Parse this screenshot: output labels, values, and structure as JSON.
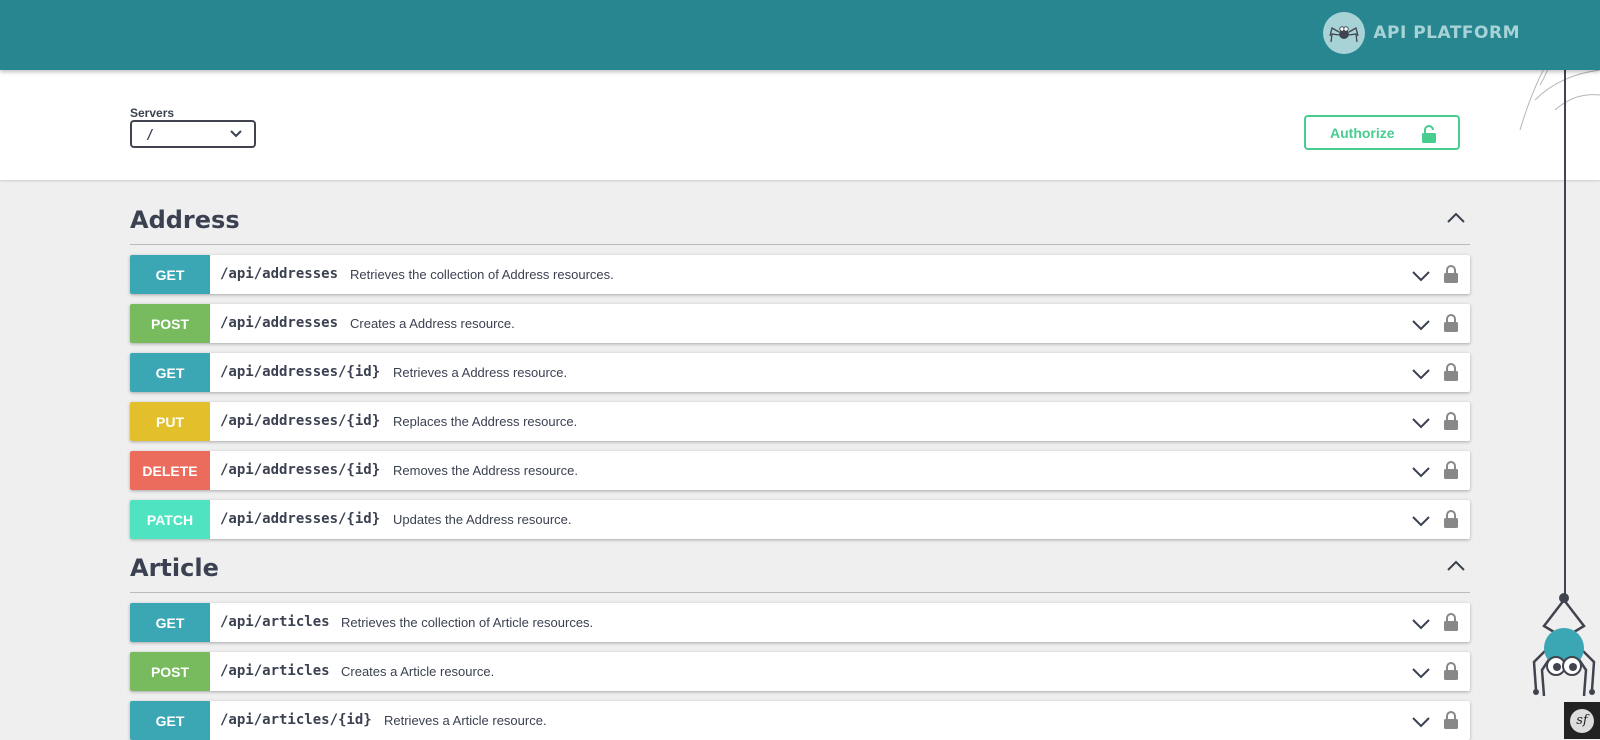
{
  "header": {
    "logo_text": "API PLATFORM",
    "logo_icon": "spider-logo-icon",
    "bg_color": "#288690"
  },
  "scheme": {
    "servers_label": "Servers",
    "servers_selected": "/",
    "authorize_label": "Authorize"
  },
  "colors": {
    "GET": "#3ca7b4",
    "POST": "#77bb5e",
    "PUT": "#e3c02b",
    "DELETE": "#eb6c5c",
    "PATCH": "#50e3c2",
    "authorize": "#49cc90"
  },
  "tags": [
    {
      "name": "Address",
      "operations": [
        {
          "method": "GET",
          "path": "/api/addresses",
          "summary": "Retrieves the collection of Address resources."
        },
        {
          "method": "POST",
          "path": "/api/addresses",
          "summary": "Creates a Address resource."
        },
        {
          "method": "GET",
          "path": "/api/addresses/{id}",
          "summary": "Retrieves a Address resource."
        },
        {
          "method": "PUT",
          "path": "/api/addresses/{id}",
          "summary": "Replaces the Address resource."
        },
        {
          "method": "DELETE",
          "path": "/api/addresses/{id}",
          "summary": "Removes the Address resource."
        },
        {
          "method": "PATCH",
          "path": "/api/addresses/{id}",
          "summary": "Updates the Address resource."
        }
      ]
    },
    {
      "name": "Article",
      "operations": [
        {
          "method": "GET",
          "path": "/api/articles",
          "summary": "Retrieves the collection of Article resources."
        },
        {
          "method": "POST",
          "path": "/api/articles",
          "summary": "Creates a Article resource."
        },
        {
          "method": "GET",
          "path": "/api/articles/{id}",
          "summary": "Retrieves a Article resource."
        }
      ]
    }
  ],
  "footer": {
    "symfony_badge": "sf"
  }
}
